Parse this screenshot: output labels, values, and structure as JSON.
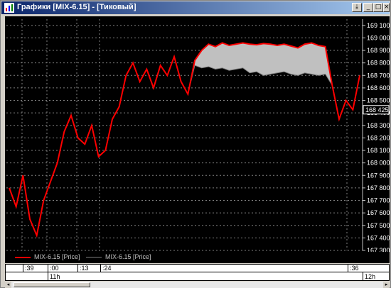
{
  "window": {
    "title": "Графики [MIX-6.15] - [Тиковый]",
    "buttons": {
      "pin": "⤓",
      "minimize": "_",
      "maximize": "□",
      "close": "×"
    }
  },
  "chart_data": {
    "type": "line",
    "ylim": [
      167300,
      169150
    ],
    "yticks": [
      "169 100",
      "169 000",
      "168 900",
      "168 800",
      "168 700",
      "168 600",
      "168 500",
      "168 400",
      "168 300",
      "168 200",
      "168 100",
      "168 000",
      "167 900",
      "167 800",
      "167 700",
      "167 600",
      "167 500",
      "167 400",
      "167 300"
    ],
    "ytick_values": [
      169100,
      169000,
      168900,
      168800,
      168700,
      168600,
      168500,
      168400,
      168300,
      168200,
      168100,
      168000,
      167900,
      167800,
      167700,
      167600,
      167500,
      167400,
      167300
    ],
    "current_price_label": "168 425",
    "current_price": 168425,
    "grid": true,
    "series": [
      {
        "name": "MIX-6.15 [Price]",
        "color": "#ff0000",
        "values": [
          167800,
          167650,
          167900,
          167550,
          167420,
          167700,
          167850,
          168000,
          168250,
          168380,
          168200,
          168150,
          168300,
          168050,
          168100,
          168350,
          168450,
          168700,
          168800,
          168650,
          168750,
          168600,
          168780,
          168700,
          168850,
          168650,
          168550,
          168820,
          168900,
          168950,
          168930,
          168960,
          168940,
          168950,
          168960,
          168950,
          168945,
          168955,
          168950,
          168940,
          168950,
          168935,
          168920,
          168950,
          168960,
          168940,
          168930,
          168620,
          168350,
          168500,
          168425,
          168700
        ]
      },
      {
        "name": "MIX-6.15 [Price]",
        "color": "#808080",
        "values": [
          167800,
          167650,
          167900,
          167550,
          167420,
          167700,
          167850,
          168000,
          168250,
          168380,
          168200,
          168150,
          168300,
          168050,
          168100,
          168350,
          168450,
          168700,
          168800,
          168650,
          168750,
          168600,
          168780,
          168700,
          168850,
          168650,
          168550,
          168780,
          168760,
          168770,
          168750,
          168760,
          168740,
          168750,
          168760,
          168720,
          168730,
          168700,
          168710,
          168720,
          168730,
          168710,
          168700,
          168720,
          168710,
          168700,
          168710,
          168620,
          168350,
          168500,
          168425,
          168700
        ]
      }
    ],
    "band_fill": "#c0c0c0"
  },
  "legend": [
    {
      "label": "MIX-6.15 [Price]",
      "color": "#ff0000"
    },
    {
      "label": "MIX-6.15 [Price]",
      "color": "#808080"
    }
  ],
  "timeaxis": {
    "top_labels": [
      ":39",
      ":00",
      ":13",
      ":24",
      ":36"
    ],
    "bottom_labels": [
      "11h",
      "12h"
    ]
  }
}
